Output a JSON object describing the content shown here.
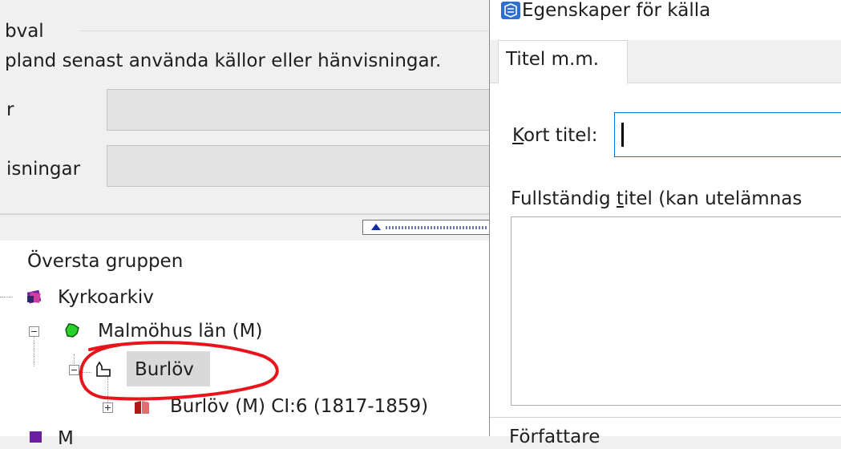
{
  "left": {
    "group_title": "bval",
    "group_description": "pland senast använda källor eller hänvisningar.",
    "field1_label": "r",
    "field2_label": "isningar",
    "tree": {
      "root": "Översta gruppen",
      "item1": "Kyrkoarkiv",
      "item2": "Malmöhus län (M)",
      "item3": "Burlöv",
      "item4": "Burlöv (M) CI:6 (1817-1859)",
      "item5_partial": "M"
    }
  },
  "dialog": {
    "title": "Egenskaper för källa",
    "tabs": [
      {
        "label": "Titel m.m."
      }
    ],
    "short_title_label_access": "K",
    "short_title_label_rest": "ort titel:",
    "short_title_value": "",
    "full_title_label_pre": "Fullständig ",
    "full_title_label_access": "t",
    "full_title_label_rest": "itel (kan utelämnas",
    "bottom_label_partial": "Författare"
  },
  "annotation_color": "#e8141c"
}
